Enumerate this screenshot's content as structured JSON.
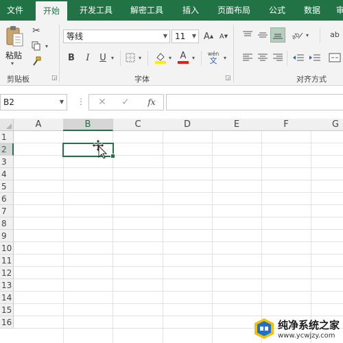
{
  "tabs": [
    {
      "label": "文件"
    },
    {
      "label": "开始"
    },
    {
      "label": "开发工具"
    },
    {
      "label": "解密工具"
    },
    {
      "label": "插入"
    },
    {
      "label": "页面布局"
    },
    {
      "label": "公式"
    },
    {
      "label": "数据"
    },
    {
      "label": "审"
    }
  ],
  "active_tab": "开始",
  "ribbon": {
    "clipboard": {
      "paste_label": "粘贴",
      "group_label": "剪贴板"
    },
    "font": {
      "font_name": "等线",
      "font_size": "11",
      "bold": "B",
      "italic": "I",
      "underline": "U",
      "phonetic_top": "wén",
      "phonetic_bottom": "文",
      "group_label": "字体",
      "grow": "A",
      "shrink": "A"
    },
    "alignment": {
      "group_label": "对齐方式",
      "wrap_label": "ab"
    }
  },
  "formula_bar": {
    "name_box": "B2",
    "fx_label": "fx",
    "formula": ""
  },
  "columns": [
    "A",
    "B",
    "C",
    "D",
    "E",
    "F",
    "G"
  ],
  "rows": [
    "1",
    "2",
    "3",
    "4",
    "5",
    "6",
    "7",
    "8",
    "9",
    "10",
    "11",
    "12",
    "13",
    "14",
    "15",
    "16"
  ],
  "selected_cell": {
    "column": "B",
    "row": "2"
  },
  "colors": {
    "accent": "#217346",
    "font_color": "#e02020",
    "fill_color": "#ffee00"
  },
  "watermark": {
    "title": "纯净系统之家",
    "url": "www.ycwjzy.com"
  }
}
